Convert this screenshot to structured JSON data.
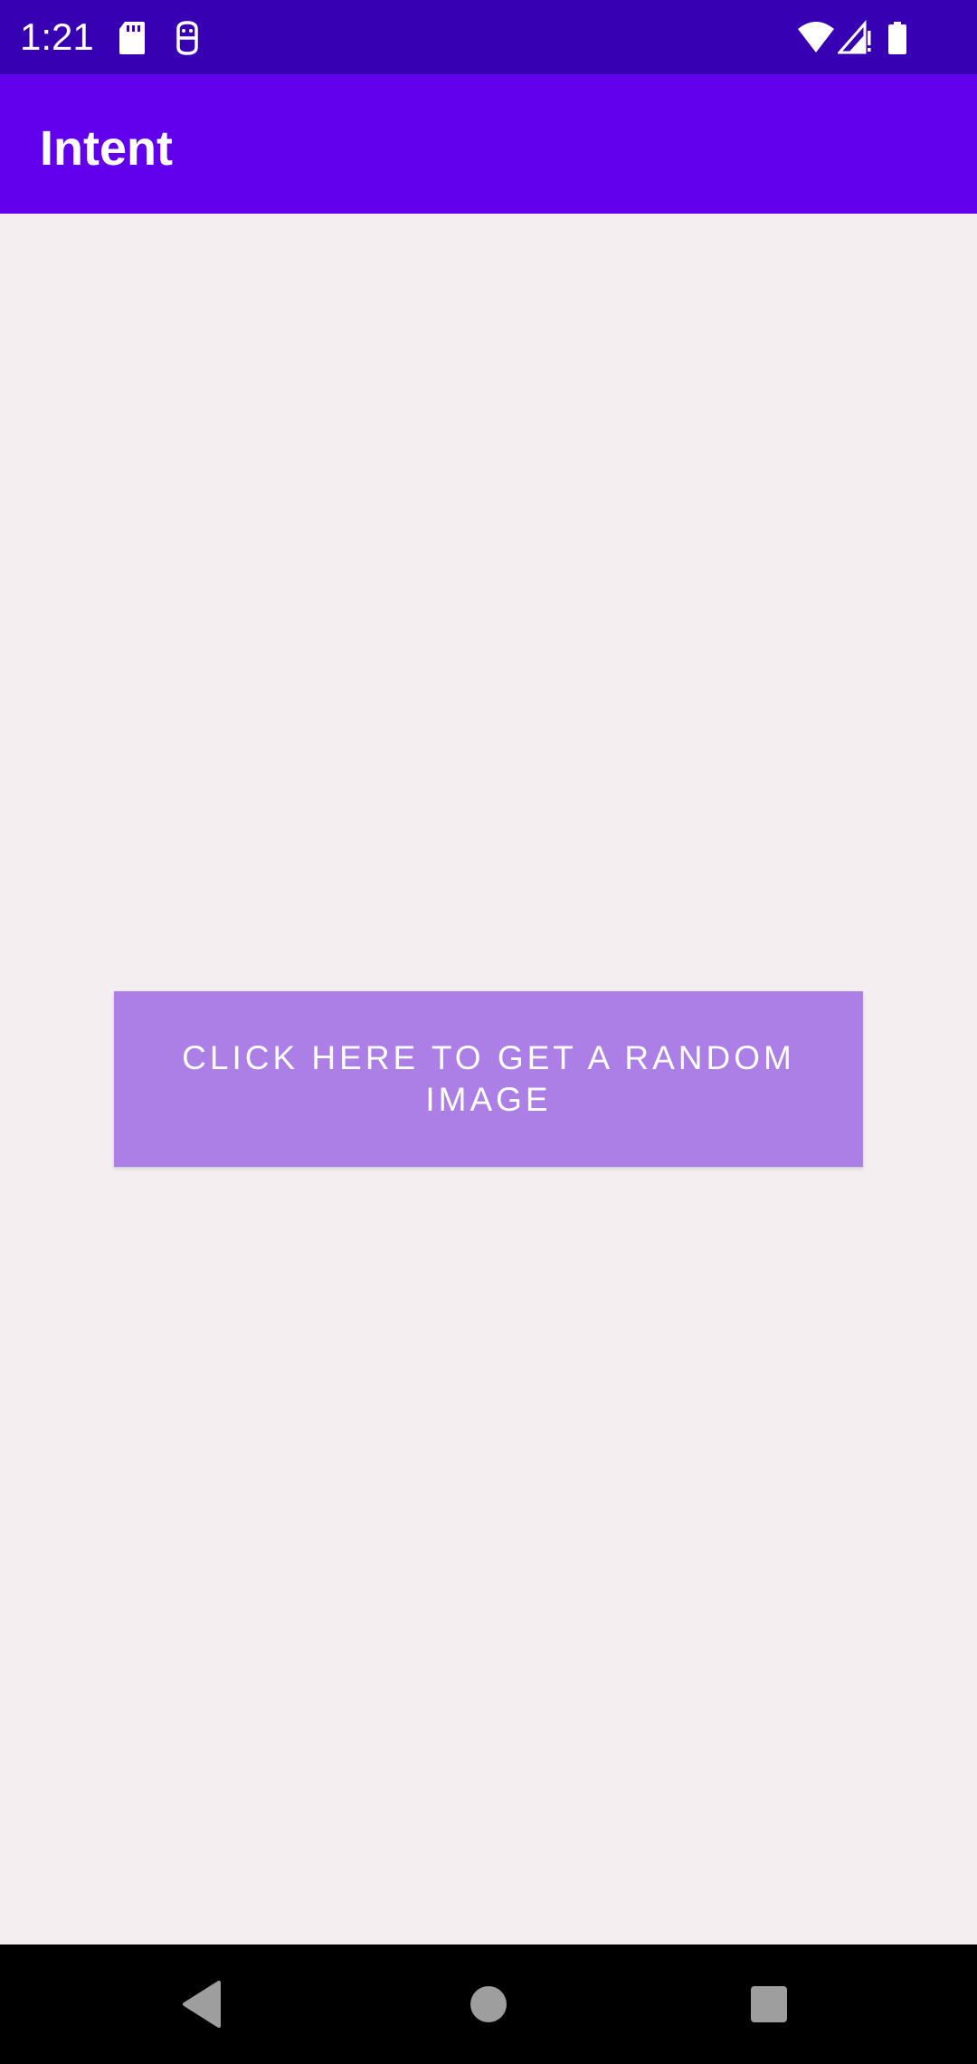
{
  "status_bar": {
    "time": "1:21",
    "icons": [
      "sd-card-icon",
      "sim-icon",
      "wifi-icon",
      "signal-icon",
      "battery-icon"
    ]
  },
  "app_bar": {
    "title": "Intent"
  },
  "main": {
    "button_label": "CLICK HERE TO GET A RANDOM IMAGE"
  },
  "nav_bar": {
    "buttons": [
      "back-icon",
      "home-icon",
      "recents-icon"
    ]
  },
  "colors": {
    "status_bar": "#3700b3",
    "app_bar": "#6200ee",
    "background": "#f4eef0",
    "button": "#ab7fe6",
    "nav_bar": "#000000"
  }
}
